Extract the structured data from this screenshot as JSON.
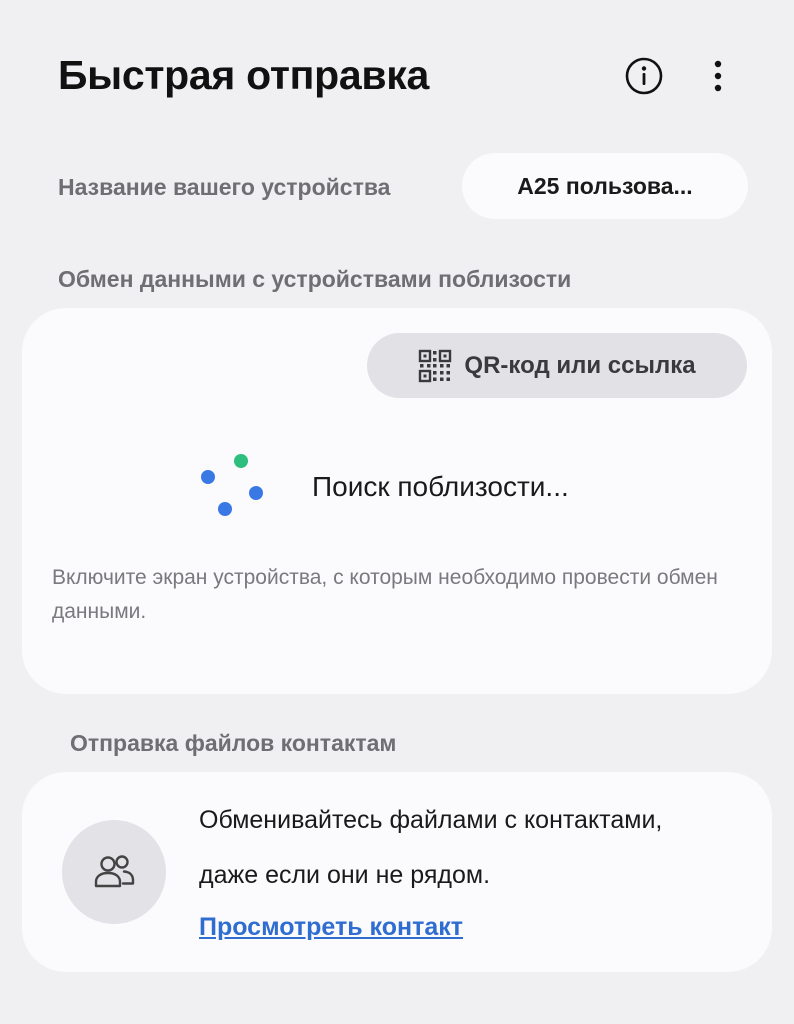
{
  "header": {
    "title": "Быстрая отправка",
    "info_icon": "info-circle-icon",
    "more_icon": "more-vertical-icon"
  },
  "device": {
    "label": "Название вашего устройства",
    "name": "A25 пользова..."
  },
  "nearby": {
    "header": "Обмен данными с устройствами поблизости",
    "qr_button_label": "QR-код или ссылка",
    "qr_icon": "qr-code-icon",
    "searching_text": "Поиск поблизости...",
    "hint": "Включите экран устройства, с которым необходимо провести обмен данными."
  },
  "contacts": {
    "header": "Отправка файлов контактам",
    "line1": "Обменивайтесь файлами с контактами,",
    "line2": "даже если они не рядом.",
    "link": "Просмотреть контакт",
    "icon": "people-icon"
  },
  "colors": {
    "background": "#f0f0f2",
    "card": "#fbfbfd",
    "link": "#2f6dd0",
    "spinner_green": "#2ebf7e",
    "spinner_blue": "#3a78e6"
  }
}
